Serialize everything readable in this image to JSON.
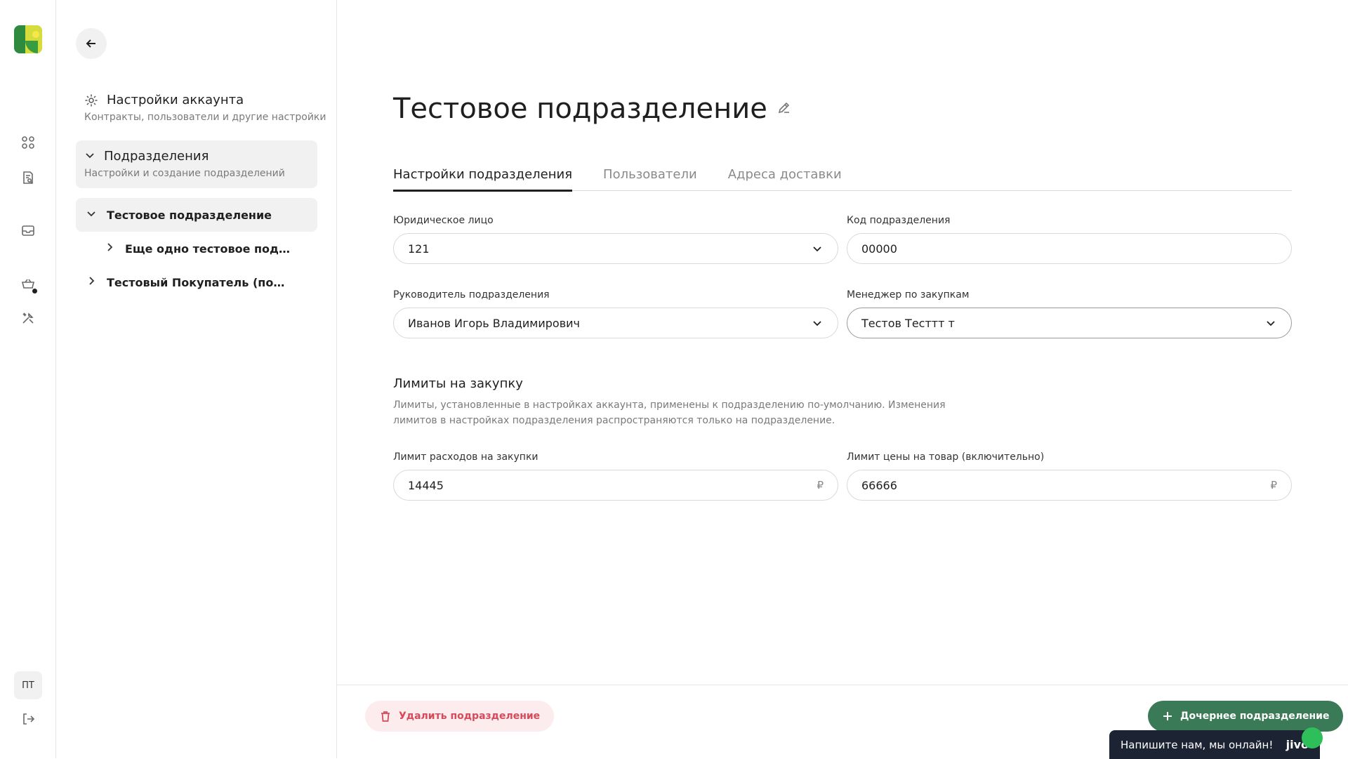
{
  "rail": {
    "avatar_initials": "ПТ",
    "icons": [
      "apps-icon",
      "document-search-icon",
      "inbox-icon",
      "cart-icon",
      "tools-icon",
      "logout-icon"
    ]
  },
  "subnav": {
    "account": {
      "title": "Настройки аккаунта",
      "subtitle": "Контракты, пользователи и другие настройки"
    },
    "section": {
      "title": "Подразделения",
      "subtitle": "Настройки и создание подразделений"
    },
    "tree": [
      {
        "label": "Тестовое подразделение"
      },
      {
        "label": "Еще одно тестовое подразделение"
      },
      {
        "label": "Тестовый Покупатель (подразделение)"
      }
    ]
  },
  "main": {
    "title": "Тестовое подразделение",
    "tabs": [
      {
        "label": "Настройки подразделения"
      },
      {
        "label": "Пользователи"
      },
      {
        "label": "Адреса доставки"
      }
    ],
    "fields": {
      "legal_entity": {
        "label": "Юридическое лицо",
        "value": "121"
      },
      "dept_code": {
        "label": "Код подразделения",
        "value": "00000"
      },
      "head": {
        "label": "Руководитель подразделения",
        "value": "Иванов Игорь Владимирович"
      },
      "manager": {
        "label": "Менеджер по закупкам",
        "value": "Тестов Тесттт т"
      }
    },
    "limits": {
      "title": "Лимиты на закупку",
      "description": "Лимиты, установленные в настройках аккаунта, применены к подразделению по-умолчанию. Изменения лимитов в настройках подразделения распространяются только на подразделение.",
      "spend": {
        "label": "Лимит расходов на закупки",
        "value": "14445",
        "currency": "₽"
      },
      "price": {
        "label": "Лимит цены на товар (включительно)",
        "value": "66666",
        "currency": "₽"
      }
    },
    "footer": {
      "delete_label": "Удалить подразделение",
      "child_label": "Дочернее подразделение"
    },
    "chat": {
      "text": "Напишите нам, мы онлайн!",
      "brand": "jivo"
    }
  },
  "colors": {
    "accent": "#3b7a57",
    "danger": "#d64a5a",
    "danger_bg": "#fdecee",
    "chat_bg": "#1c2333"
  }
}
